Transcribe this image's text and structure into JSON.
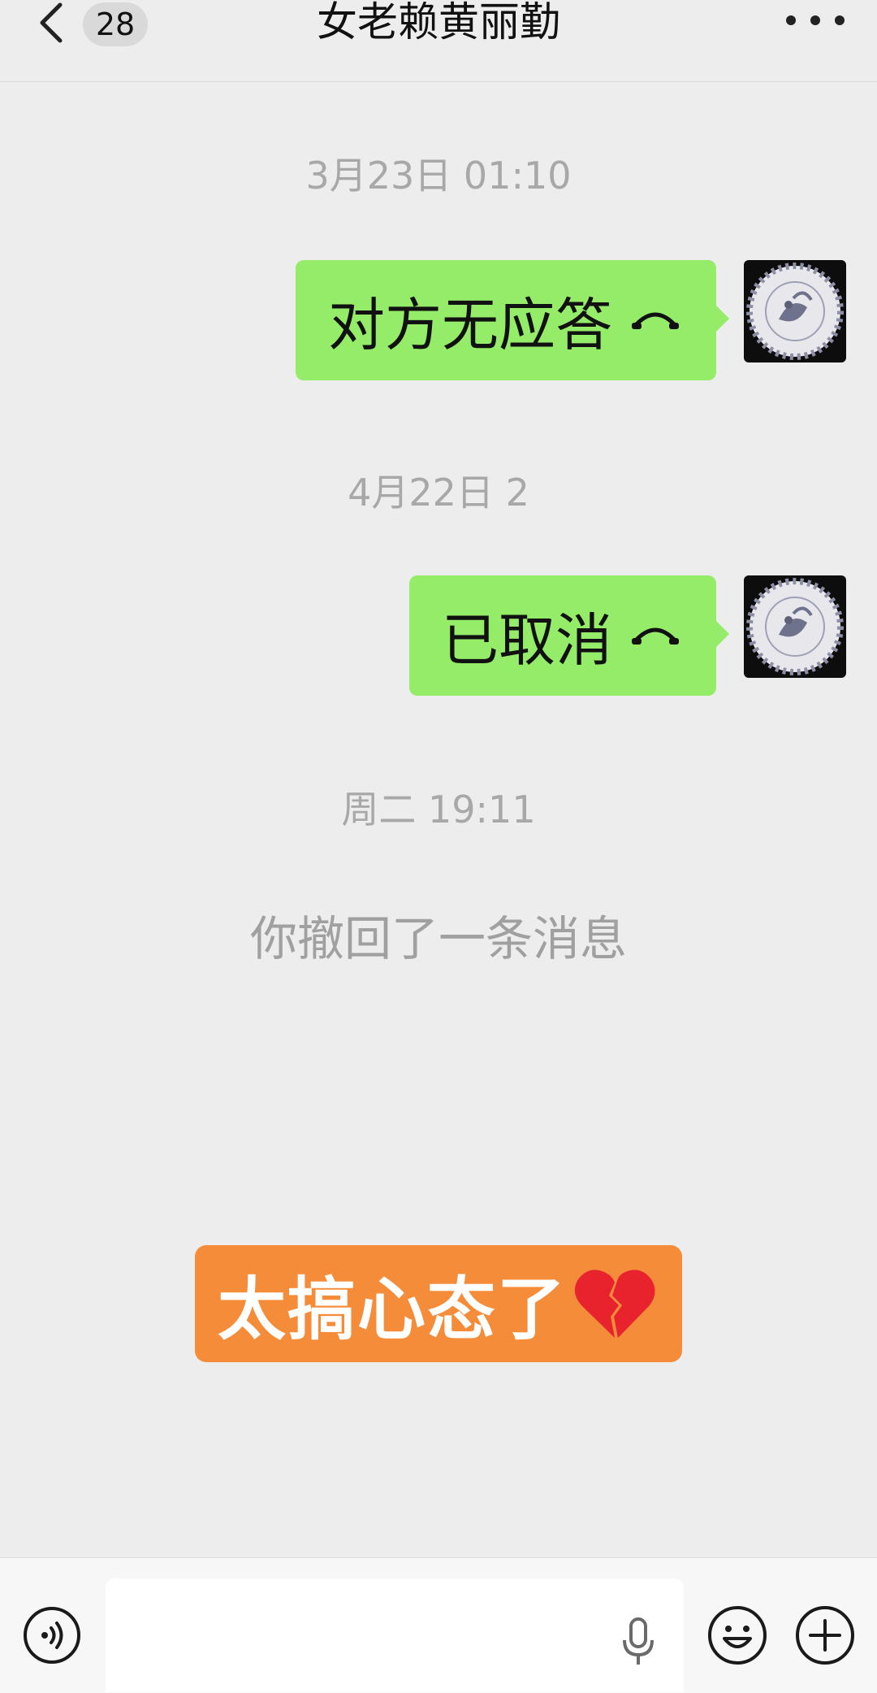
{
  "header": {
    "title": "女老赖黄丽勤",
    "unread_count": "28",
    "icons": {
      "back": "chevron-left-icon",
      "more": "more-dots-icon"
    }
  },
  "messages": [
    {
      "timestamp": "3月23日 01:10",
      "text": "对方无应答",
      "icon": "phone-hangup-icon"
    },
    {
      "timestamp": "4月22日 2",
      "text": "已取消",
      "icon": "phone-hangup-icon"
    }
  ],
  "recall": {
    "timestamp": "周二 19:11",
    "text": "你撤回了一条消息"
  },
  "overlay": {
    "text": "太搞心态了",
    "icon": "broken-heart-icon",
    "color": "#f58c3a"
  },
  "input_bar": {
    "icons": {
      "voice": "voice-icon",
      "mic": "microphone-icon",
      "emoji": "emoji-icon",
      "more": "plus-icon"
    }
  },
  "colors": {
    "bubble": "#95ec69",
    "background": "#ededed",
    "timestamp": "#a8a8a8"
  }
}
